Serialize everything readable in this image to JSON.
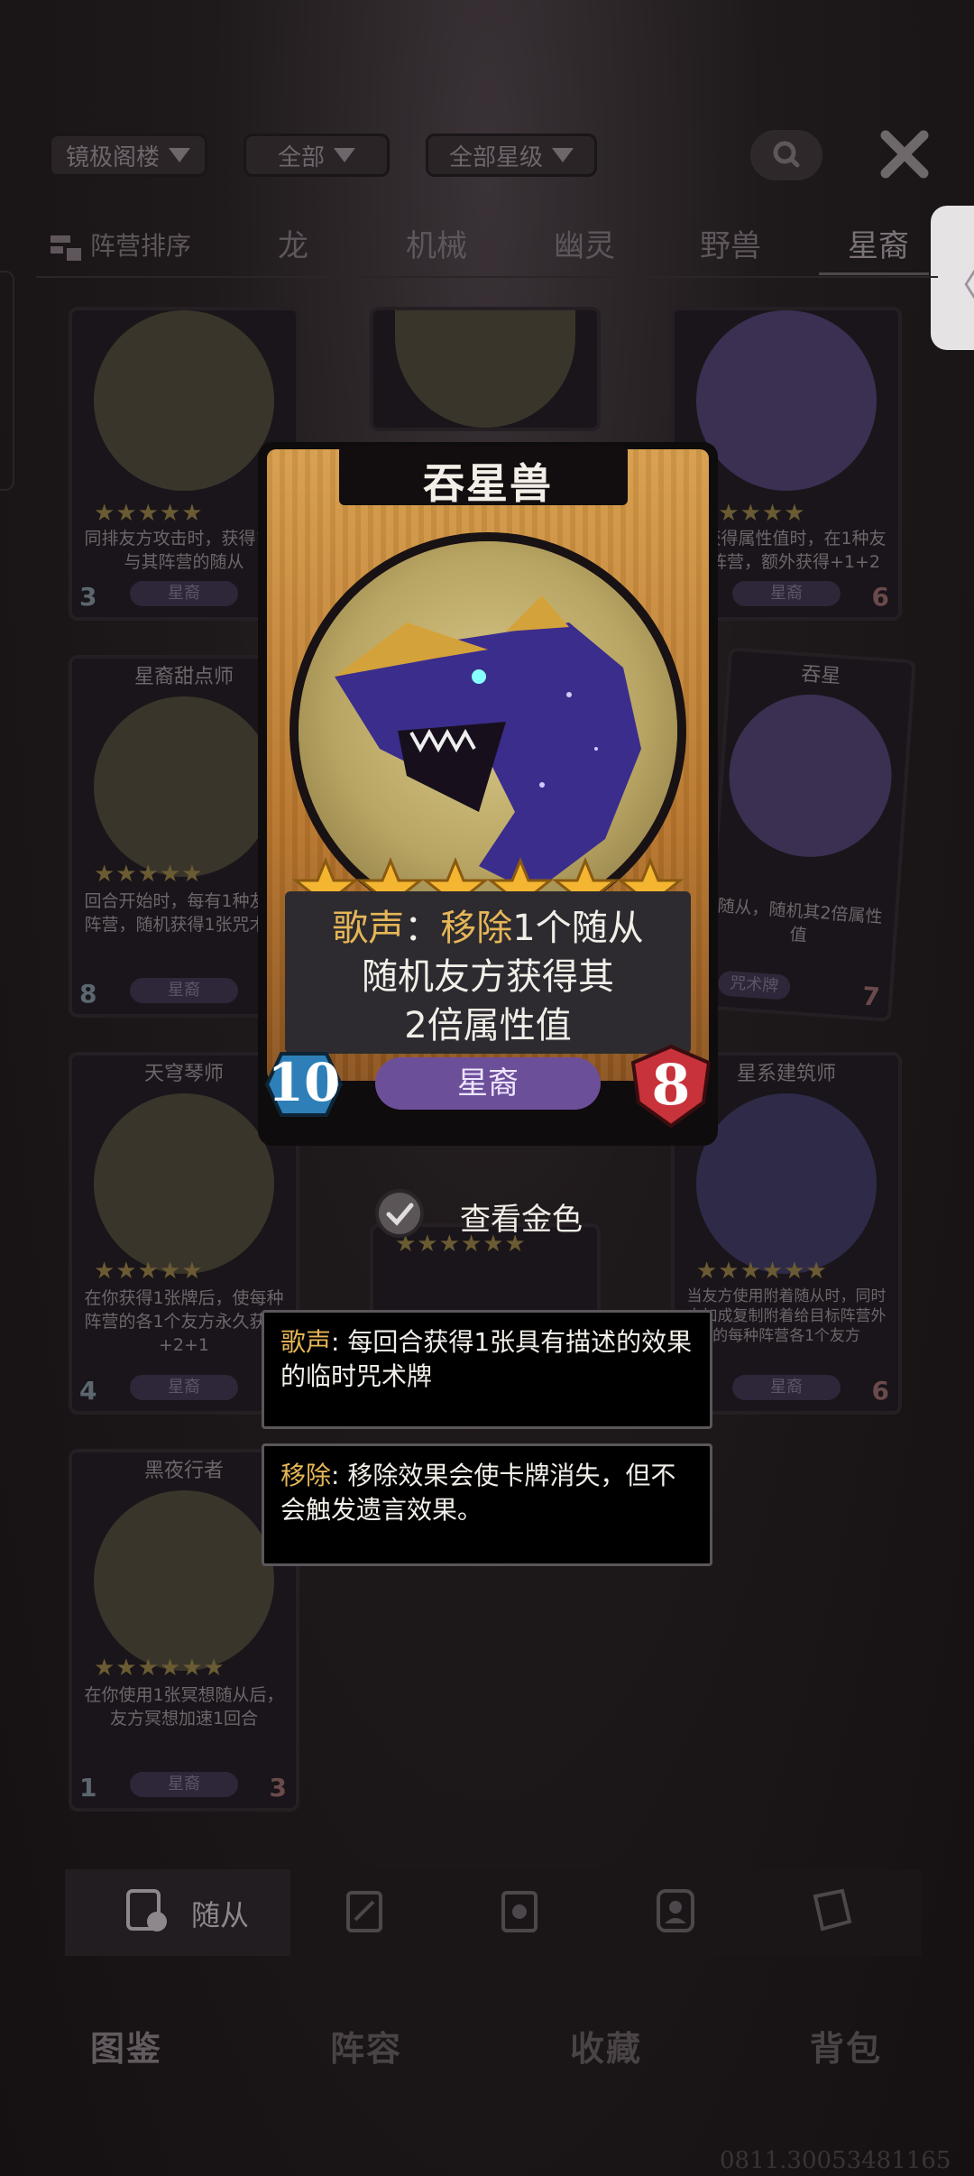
{
  "filters": [
    {
      "label": "镜极阁楼"
    },
    {
      "label": "全部"
    },
    {
      "label": "全部星级"
    }
  ],
  "tabs": {
    "sort_label": "阵营排序",
    "items": [
      "龙",
      "机械",
      "幽灵",
      "野兽",
      "星裔"
    ],
    "active": "星裔"
  },
  "side_tab": {
    "glyph": "〈"
  },
  "cards": [
    {
      "name": "",
      "desc": "同排友方攻击时，获得1张与其阵营的随从",
      "race": "星裔",
      "cost": "3",
      "attack": ""
    },
    {
      "name": "",
      "desc": "",
      "race": "",
      "cost": "",
      "attack": ""
    },
    {
      "name": "",
      "desc": "从获得属性值时，在1种友方阵营，额外获得+1+2",
      "race": "星裔",
      "cost": "",
      "attack": "6"
    },
    {
      "name": "星裔甜点师",
      "desc": "回合开始时，每有1种友方阵营，随机获得1张咒术牌",
      "race": "星裔",
      "cost": "8",
      "attack": ""
    },
    {
      "name": "吞星",
      "desc": "随从，随机其2倍属性值",
      "race": "咒术牌",
      "cost": "",
      "attack": "7"
    },
    {
      "name": "天穹琴师",
      "desc": "在你获得1张牌后，使每种阵营的各1个友方永久获得+2+1",
      "race": "星裔",
      "cost": "4",
      "attack": ""
    },
    {
      "name": "星系建筑师",
      "desc": "当友方使用附着随从时，同时未加成复制附着给目标阵营外的每种阵营各1个友方",
      "race": "星裔",
      "cost": "",
      "attack": "6"
    },
    {
      "name": "黑夜行者",
      "desc": "在你使用1张冥想随从后，友方冥想加速1回合",
      "race": "星裔",
      "cost": "1",
      "attack": "3"
    }
  ],
  "featured": {
    "title": "吞星兽",
    "stars": 6,
    "text_kw1": "歌声",
    "text_sep": "：",
    "text_kw2": "移除",
    "text_rest1": "1个随从",
    "text_line2": "随机友方获得其",
    "text_line3": "2倍属性值",
    "race": "星裔",
    "cost": "10",
    "attack": "8"
  },
  "view_gold": {
    "label": "查看金色"
  },
  "tooltips": [
    {
      "keyword": "歌声",
      "text": ": 每回合获得1张具有描述的效果的临时咒术牌"
    },
    {
      "keyword": "移除",
      "text": ": 移除效果会使卡牌消失，但不会触发遗言效果。"
    }
  ],
  "categories": {
    "active_label": "随从",
    "icons": [
      "minion-icon",
      "spell-icon",
      "trinket-icon",
      "hero-icon",
      "book-icon"
    ]
  },
  "nav": [
    "图鉴",
    "阵容",
    "收藏",
    "背包"
  ],
  "nav_active": "图鉴",
  "version": "0811.3005348116​5",
  "colors": {
    "gold_keyword": "#e6b657",
    "race_purple": "#6c4f99",
    "attack_red": "#c8323a",
    "cost_blue": "#2e7fb8"
  }
}
